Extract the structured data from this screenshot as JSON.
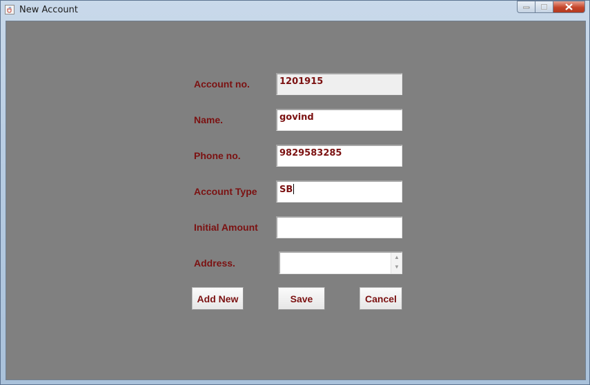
{
  "window": {
    "title": "New Account"
  },
  "form": {
    "account_no": {
      "label": "Account no.",
      "value": "1201915"
    },
    "name": {
      "label": "Name.",
      "value": "govind"
    },
    "phone_no": {
      "label": "Phone no.",
      "value": "9829583285"
    },
    "account_type": {
      "label": "Account Type",
      "value": "SB"
    },
    "initial_amount": {
      "label": "Initial Amount",
      "value": ""
    },
    "address": {
      "label": "Address.",
      "value": ""
    }
  },
  "buttons": {
    "add_new": "Add New",
    "save": "Save",
    "cancel": "Cancel"
  },
  "colors": {
    "label_text": "#7b1111",
    "panel_bg": "#808080"
  },
  "icons": {
    "app": "java-cup-icon",
    "minimize": "minimize-icon",
    "maximize": "maximize-icon",
    "close": "close-icon"
  }
}
